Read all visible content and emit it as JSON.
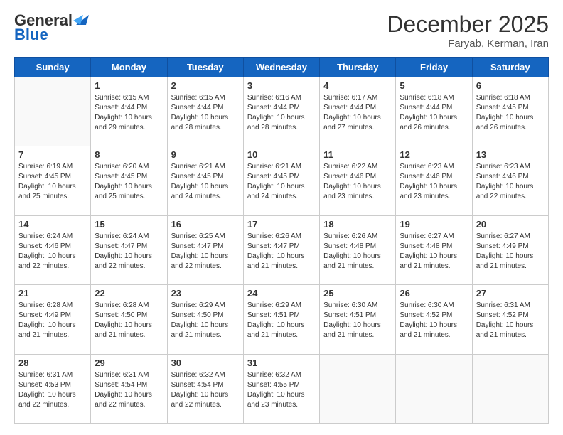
{
  "logo": {
    "general": "General",
    "blue": "Blue"
  },
  "header": {
    "month": "December 2025",
    "location": "Faryab, Kerman, Iran"
  },
  "weekdays": [
    "Sunday",
    "Monday",
    "Tuesday",
    "Wednesday",
    "Thursday",
    "Friday",
    "Saturday"
  ],
  "weeks": [
    [
      {
        "day": "",
        "sunrise": "",
        "sunset": "",
        "daylight": ""
      },
      {
        "day": "1",
        "sunrise": "Sunrise: 6:15 AM",
        "sunset": "Sunset: 4:44 PM",
        "daylight": "Daylight: 10 hours and 29 minutes."
      },
      {
        "day": "2",
        "sunrise": "Sunrise: 6:15 AM",
        "sunset": "Sunset: 4:44 PM",
        "daylight": "Daylight: 10 hours and 28 minutes."
      },
      {
        "day": "3",
        "sunrise": "Sunrise: 6:16 AM",
        "sunset": "Sunset: 4:44 PM",
        "daylight": "Daylight: 10 hours and 28 minutes."
      },
      {
        "day": "4",
        "sunrise": "Sunrise: 6:17 AM",
        "sunset": "Sunset: 4:44 PM",
        "daylight": "Daylight: 10 hours and 27 minutes."
      },
      {
        "day": "5",
        "sunrise": "Sunrise: 6:18 AM",
        "sunset": "Sunset: 4:44 PM",
        "daylight": "Daylight: 10 hours and 26 minutes."
      },
      {
        "day": "6",
        "sunrise": "Sunrise: 6:18 AM",
        "sunset": "Sunset: 4:45 PM",
        "daylight": "Daylight: 10 hours and 26 minutes."
      }
    ],
    [
      {
        "day": "7",
        "sunrise": "Sunrise: 6:19 AM",
        "sunset": "Sunset: 4:45 PM",
        "daylight": "Daylight: 10 hours and 25 minutes."
      },
      {
        "day": "8",
        "sunrise": "Sunrise: 6:20 AM",
        "sunset": "Sunset: 4:45 PM",
        "daylight": "Daylight: 10 hours and 25 minutes."
      },
      {
        "day": "9",
        "sunrise": "Sunrise: 6:21 AM",
        "sunset": "Sunset: 4:45 PM",
        "daylight": "Daylight: 10 hours and 24 minutes."
      },
      {
        "day": "10",
        "sunrise": "Sunrise: 6:21 AM",
        "sunset": "Sunset: 4:45 PM",
        "daylight": "Daylight: 10 hours and 24 minutes."
      },
      {
        "day": "11",
        "sunrise": "Sunrise: 6:22 AM",
        "sunset": "Sunset: 4:46 PM",
        "daylight": "Daylight: 10 hours and 23 minutes."
      },
      {
        "day": "12",
        "sunrise": "Sunrise: 6:23 AM",
        "sunset": "Sunset: 4:46 PM",
        "daylight": "Daylight: 10 hours and 23 minutes."
      },
      {
        "day": "13",
        "sunrise": "Sunrise: 6:23 AM",
        "sunset": "Sunset: 4:46 PM",
        "daylight": "Daylight: 10 hours and 22 minutes."
      }
    ],
    [
      {
        "day": "14",
        "sunrise": "Sunrise: 6:24 AM",
        "sunset": "Sunset: 4:46 PM",
        "daylight": "Daylight: 10 hours and 22 minutes."
      },
      {
        "day": "15",
        "sunrise": "Sunrise: 6:24 AM",
        "sunset": "Sunset: 4:47 PM",
        "daylight": "Daylight: 10 hours and 22 minutes."
      },
      {
        "day": "16",
        "sunrise": "Sunrise: 6:25 AM",
        "sunset": "Sunset: 4:47 PM",
        "daylight": "Daylight: 10 hours and 22 minutes."
      },
      {
        "day": "17",
        "sunrise": "Sunrise: 6:26 AM",
        "sunset": "Sunset: 4:47 PM",
        "daylight": "Daylight: 10 hours and 21 minutes."
      },
      {
        "day": "18",
        "sunrise": "Sunrise: 6:26 AM",
        "sunset": "Sunset: 4:48 PM",
        "daylight": "Daylight: 10 hours and 21 minutes."
      },
      {
        "day": "19",
        "sunrise": "Sunrise: 6:27 AM",
        "sunset": "Sunset: 4:48 PM",
        "daylight": "Daylight: 10 hours and 21 minutes."
      },
      {
        "day": "20",
        "sunrise": "Sunrise: 6:27 AM",
        "sunset": "Sunset: 4:49 PM",
        "daylight": "Daylight: 10 hours and 21 minutes."
      }
    ],
    [
      {
        "day": "21",
        "sunrise": "Sunrise: 6:28 AM",
        "sunset": "Sunset: 4:49 PM",
        "daylight": "Daylight: 10 hours and 21 minutes."
      },
      {
        "day": "22",
        "sunrise": "Sunrise: 6:28 AM",
        "sunset": "Sunset: 4:50 PM",
        "daylight": "Daylight: 10 hours and 21 minutes."
      },
      {
        "day": "23",
        "sunrise": "Sunrise: 6:29 AM",
        "sunset": "Sunset: 4:50 PM",
        "daylight": "Daylight: 10 hours and 21 minutes."
      },
      {
        "day": "24",
        "sunrise": "Sunrise: 6:29 AM",
        "sunset": "Sunset: 4:51 PM",
        "daylight": "Daylight: 10 hours and 21 minutes."
      },
      {
        "day": "25",
        "sunrise": "Sunrise: 6:30 AM",
        "sunset": "Sunset: 4:51 PM",
        "daylight": "Daylight: 10 hours and 21 minutes."
      },
      {
        "day": "26",
        "sunrise": "Sunrise: 6:30 AM",
        "sunset": "Sunset: 4:52 PM",
        "daylight": "Daylight: 10 hours and 21 minutes."
      },
      {
        "day": "27",
        "sunrise": "Sunrise: 6:31 AM",
        "sunset": "Sunset: 4:52 PM",
        "daylight": "Daylight: 10 hours and 21 minutes."
      }
    ],
    [
      {
        "day": "28",
        "sunrise": "Sunrise: 6:31 AM",
        "sunset": "Sunset: 4:53 PM",
        "daylight": "Daylight: 10 hours and 22 minutes."
      },
      {
        "day": "29",
        "sunrise": "Sunrise: 6:31 AM",
        "sunset": "Sunset: 4:54 PM",
        "daylight": "Daylight: 10 hours and 22 minutes."
      },
      {
        "day": "30",
        "sunrise": "Sunrise: 6:32 AM",
        "sunset": "Sunset: 4:54 PM",
        "daylight": "Daylight: 10 hours and 22 minutes."
      },
      {
        "day": "31",
        "sunrise": "Sunrise: 6:32 AM",
        "sunset": "Sunset: 4:55 PM",
        "daylight": "Daylight: 10 hours and 23 minutes."
      },
      {
        "day": "",
        "sunrise": "",
        "sunset": "",
        "daylight": ""
      },
      {
        "day": "",
        "sunrise": "",
        "sunset": "",
        "daylight": ""
      },
      {
        "day": "",
        "sunrise": "",
        "sunset": "",
        "daylight": ""
      }
    ]
  ]
}
